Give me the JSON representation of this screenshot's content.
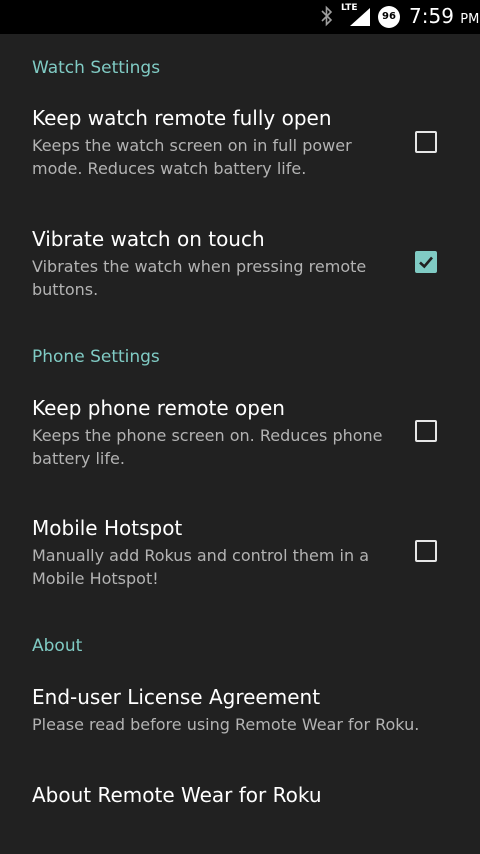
{
  "status_bar": {
    "network": "LTE",
    "battery_level": "96",
    "time": "7:59",
    "ampm": "PM",
    "icons": [
      "bluetooth-icon",
      "signal-icon",
      "battery-icon"
    ]
  },
  "sections": {
    "watch": {
      "header": "Watch Settings",
      "items": [
        {
          "title": "Keep watch remote fully open",
          "summary": "Keeps the watch screen on in full power mode. Reduces watch battery life.",
          "checked": false
        },
        {
          "title": "Vibrate watch on touch",
          "summary": "Vibrates the watch when pressing remote buttons.",
          "checked": true
        }
      ]
    },
    "phone": {
      "header": "Phone Settings",
      "items": [
        {
          "title": "Keep phone remote open",
          "summary": "Keeps the phone screen on. Reduces phone battery life.",
          "checked": false
        },
        {
          "title": "Mobile Hotspot",
          "summary": "Manually add Rokus and control them in a Mobile Hotspot!",
          "checked": false
        }
      ]
    },
    "about": {
      "header": "About",
      "items": [
        {
          "title": "End-user License Agreement",
          "summary": "Please read before using Remote Wear for Roku."
        },
        {
          "title": "About Remote Wear for Roku"
        }
      ]
    }
  },
  "colors": {
    "accent": "#80cbc4",
    "background": "#212121",
    "summary_text": "#b3b3b3"
  }
}
